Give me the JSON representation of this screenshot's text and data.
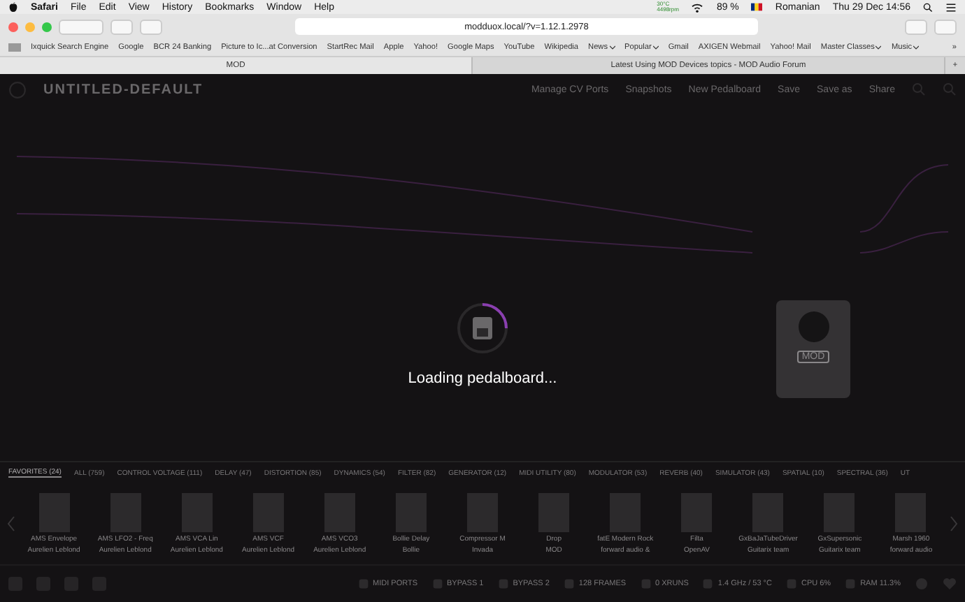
{
  "menu_bar": {
    "app": "Safari",
    "menus": [
      "File",
      "Edit",
      "View",
      "History",
      "Bookmarks",
      "Window",
      "Help"
    ],
    "temperature": "30°C",
    "fan": "4498rpm",
    "battery": "89 %",
    "input_source": "Romanian",
    "clock": "Thu 29 Dec 14:56"
  },
  "browser": {
    "url": "modduox.local/?v=1.12.1.2978",
    "bookmarks": [
      {
        "label": "Ixquick Search Engine",
        "menu": false
      },
      {
        "label": "Google",
        "menu": false
      },
      {
        "label": "BCR 24 Banking",
        "menu": false
      },
      {
        "label": "Picture to Ic...at Conversion",
        "menu": false
      },
      {
        "label": "StartRec Mail",
        "menu": false
      },
      {
        "label": "Apple",
        "menu": false
      },
      {
        "label": "Yahoo!",
        "menu": false
      },
      {
        "label": "Google Maps",
        "menu": false
      },
      {
        "label": "YouTube",
        "menu": false
      },
      {
        "label": "Wikipedia",
        "menu": false
      },
      {
        "label": "News",
        "menu": true
      },
      {
        "label": "Popular",
        "menu": true
      },
      {
        "label": "Gmail",
        "menu": false
      },
      {
        "label": "AXIGEN Webmail",
        "menu": false
      },
      {
        "label": "Yahoo! Mail",
        "menu": false
      },
      {
        "label": "Master Classes",
        "menu": true
      },
      {
        "label": "Music",
        "menu": true
      }
    ],
    "bookmarks_more": "»",
    "new_tab": "+",
    "tabs": [
      {
        "label": "MOD",
        "selected": true
      },
      {
        "label": "Latest Using MOD Devices topics - MOD Audio Forum",
        "selected": false
      }
    ]
  },
  "app": {
    "title": "UNTITLED-DEFAULT",
    "toolbar": [
      "Manage CV Ports",
      "Snapshots",
      "New Pedalboard",
      "Save",
      "Save as",
      "Share"
    ],
    "pedal": {
      "label": "MOD"
    },
    "loading": "Loading pedalboard...",
    "categories": [
      {
        "label": "FAVORITES (24)",
        "selected": true
      },
      {
        "label": "ALL (759)",
        "selected": false
      },
      {
        "label": "CONTROL VOLTAGE (111)",
        "selected": false
      },
      {
        "label": "DELAY (47)",
        "selected": false
      },
      {
        "label": "DISTORTION (85)",
        "selected": false
      },
      {
        "label": "DYNAMICS (54)",
        "selected": false
      },
      {
        "label": "FILTER (82)",
        "selected": false
      },
      {
        "label": "GENERATOR (12)",
        "selected": false
      },
      {
        "label": "MIDI UTILITY (80)",
        "selected": false
      },
      {
        "label": "MODULATOR (53)",
        "selected": false
      },
      {
        "label": "REVERB (40)",
        "selected": false
      },
      {
        "label": "SIMULATOR (43)",
        "selected": false
      },
      {
        "label": "SPATIAL (10)",
        "selected": false
      },
      {
        "label": "SPECTRAL (36)",
        "selected": false
      },
      {
        "label": "UT",
        "selected": false
      }
    ],
    "plugins": [
      {
        "name": "AMS Envelope",
        "author": "Aurelien Leblond"
      },
      {
        "name": "AMS LFO2 - Freq",
        "author": "Aurelien Leblond"
      },
      {
        "name": "AMS VCA Lin",
        "author": "Aurelien Leblond"
      },
      {
        "name": "AMS VCF",
        "author": "Aurelien Leblond"
      },
      {
        "name": "AMS VCO3",
        "author": "Aurelien Leblond"
      },
      {
        "name": "Bollie Delay",
        "author": "Bollie"
      },
      {
        "name": "Compressor M",
        "author": "Invada"
      },
      {
        "name": "Drop",
        "author": "MOD"
      },
      {
        "name": "fatE Modern Rock",
        "author": "forward audio &"
      },
      {
        "name": "Filta",
        "author": "OpenAV"
      },
      {
        "name": "GxBaJaTubeDriver",
        "author": "Guitarix team"
      },
      {
        "name": "GxSupersonic",
        "author": "Guitarix team"
      },
      {
        "name": "Marsh 1960",
        "author": "forward audio"
      }
    ],
    "status": [
      "MIDI PORTS",
      "BYPASS 1",
      "BYPASS 2",
      "128 FRAMES",
      "0 XRUNS",
      "1.4 GHz / 53 °C",
      "CPU 6%",
      "RAM 11.3%"
    ]
  }
}
